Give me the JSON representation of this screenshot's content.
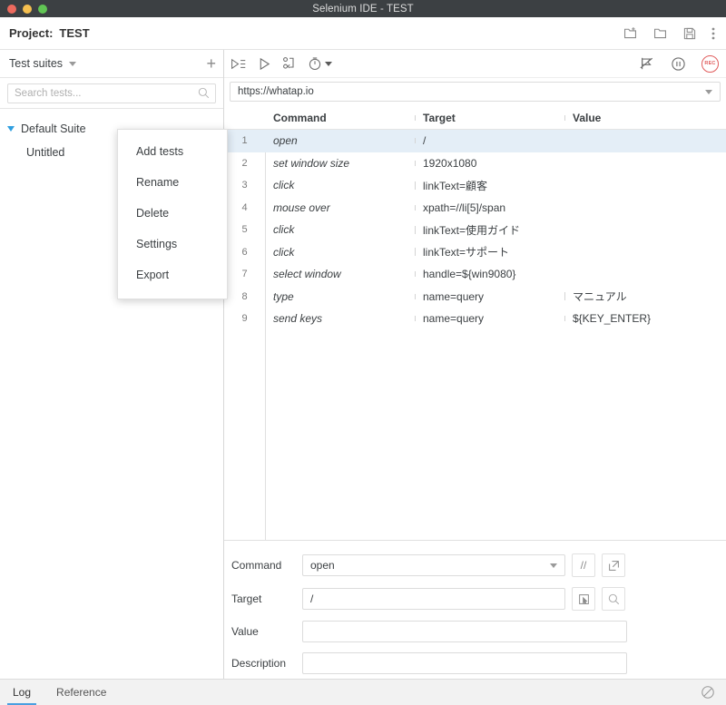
{
  "window": {
    "title": "Selenium IDE - TEST",
    "controls": [
      "close",
      "minimize",
      "maximize"
    ]
  },
  "project_bar": {
    "label": "Project:",
    "name": "TEST",
    "actions": [
      {
        "name": "new-project-icon",
        "label": "New project"
      },
      {
        "name": "open-project-icon",
        "label": "Open project"
      },
      {
        "name": "save-project-icon",
        "label": "Save project"
      },
      {
        "name": "more-menu-icon",
        "label": "More"
      }
    ]
  },
  "sidebar": {
    "header": "Test suites",
    "add_label": "+",
    "search": {
      "value": "",
      "placeholder": "Search tests..."
    },
    "tree": {
      "suite": "Default Suite",
      "tests": [
        "Untitled"
      ]
    }
  },
  "context_menu": {
    "items": [
      "Add tests",
      "Rename",
      "Delete",
      "Settings",
      "Export"
    ]
  },
  "toolbar": {
    "left": [
      {
        "name": "run-all-tests-icon",
        "label": "Run all tests"
      },
      {
        "name": "run-current-test-icon",
        "label": "Run current test"
      },
      {
        "name": "step-over-icon",
        "label": "Step over"
      },
      {
        "name": "execution-speed-icon",
        "label": "Test execution speed"
      }
    ],
    "right": [
      {
        "name": "toggle-breakpoints-icon",
        "label": "Disable breakpoints"
      },
      {
        "name": "pause-icon",
        "label": "Pause"
      },
      {
        "name": "record-icon",
        "label": "REC"
      }
    ],
    "record_text": "REC"
  },
  "url_bar": {
    "value": "https://whatap.io"
  },
  "table": {
    "columns": [
      "",
      "Command",
      "Target",
      "Value"
    ],
    "selected_row": 1,
    "rows": [
      {
        "n": "1",
        "command": "open",
        "target": "/",
        "value": ""
      },
      {
        "n": "2",
        "command": "set window size",
        "target": "1920x1080",
        "value": ""
      },
      {
        "n": "3",
        "command": "click",
        "target": "linkText=顧客",
        "value": ""
      },
      {
        "n": "4",
        "command": "mouse over",
        "target": "xpath=//li[5]/span",
        "value": ""
      },
      {
        "n": "5",
        "command": "click",
        "target": "linkText=使用ガイド",
        "value": ""
      },
      {
        "n": "6",
        "command": "click",
        "target": "linkText=サポート",
        "value": ""
      },
      {
        "n": "7",
        "command": "select window",
        "target": "handle=${win9080}",
        "value": ""
      },
      {
        "n": "8",
        "command": "type",
        "target": "name=query",
        "value": "マニュアル"
      },
      {
        "n": "9",
        "command": "send keys",
        "target": "name=query",
        "value": "${KEY_ENTER}"
      }
    ]
  },
  "form": {
    "command": {
      "label": "Command",
      "value": "open"
    },
    "target": {
      "label": "Target",
      "value": "/"
    },
    "value": {
      "label": "Value",
      "value": ""
    },
    "description": {
      "label": "Description",
      "value": ""
    },
    "buttons": [
      {
        "name": "comment-button",
        "label": "//"
      },
      {
        "name": "open-external-button",
        "label": "↗"
      },
      {
        "name": "select-target-button",
        "label": "select"
      },
      {
        "name": "find-target-button",
        "label": "find"
      }
    ]
  },
  "status_bar": {
    "tabs": [
      {
        "label": "Log",
        "active": true
      },
      {
        "label": "Reference",
        "active": false
      }
    ],
    "clear_icon": "clear-log-icon"
  },
  "colors": {
    "titlebar": "#3c4043",
    "accent": "#4a9fe0",
    "selected_row": "#e4eef7",
    "record": "#e05b5b",
    "tree_triangle": "#2f9fe0"
  }
}
